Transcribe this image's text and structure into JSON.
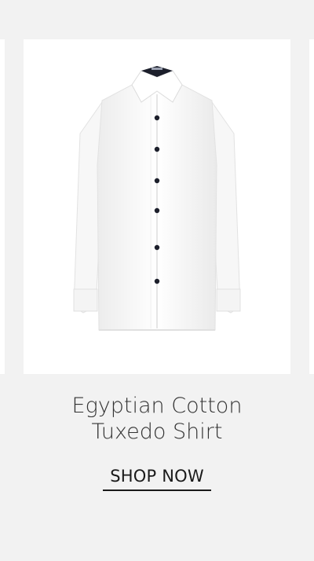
{
  "product": {
    "name_line1": "Egyptian Cotton",
    "name_line2": "Tuxedo Shirt",
    "image_alt": "white tuxedo shirt",
    "cta_label": "SHOP NOW"
  },
  "colors": {
    "background": "#f2f2f2",
    "card": "#ffffff",
    "text": "#333333",
    "button_stud": "#1c1f2b"
  }
}
